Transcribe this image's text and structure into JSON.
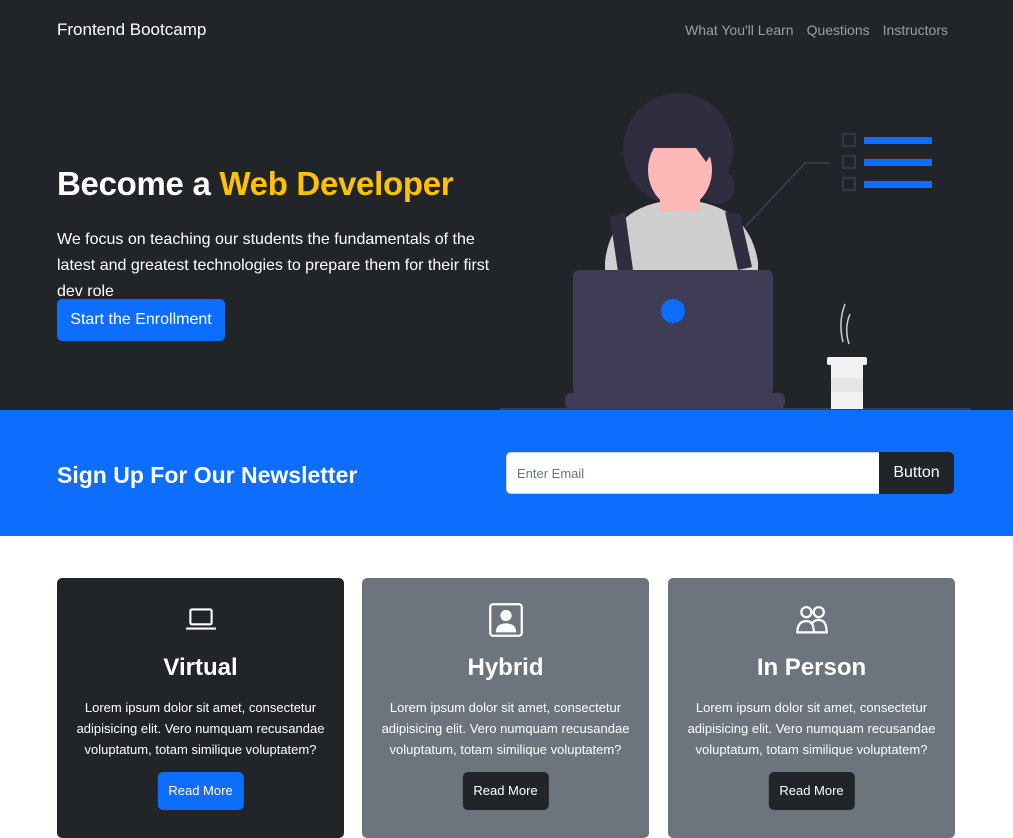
{
  "navbar": {
    "brand": "Frontend Bootcamp",
    "links": [
      "What You'll Learn",
      "Questions",
      "Instructors"
    ]
  },
  "hero": {
    "title_prefix": "Become a",
    "title_accent": "Web Developer",
    "description": "We focus on teaching our students the fundamentals of the latest and greatest technologies to prepare them for their first dev role",
    "cta_label": "Start the Enrollment"
  },
  "newsletter": {
    "heading": "Sign Up For Our Newsletter",
    "email_placeholder": "Enter Email",
    "email_value": "",
    "button_label": "Button"
  },
  "cards": [
    {
      "icon": "laptop-icon",
      "title": "Virtual",
      "text": "Lorem ipsum dolor sit amet, consectetur adipisicing elit. Vero numquam recusandae voluptatum, totam similique voluptatem?",
      "button": "Read More"
    },
    {
      "icon": "person-square-icon",
      "title": "Hybrid",
      "text": "Lorem ipsum dolor sit amet, consectetur adipisicing elit. Vero numquam recusandae voluptatum, totam similique voluptatem?",
      "button": "Read More"
    },
    {
      "icon": "people-icon",
      "title": "In Person",
      "text": "Lorem ipsum dolor sit amet, consectetur adipisicing elit. Vero numquam recusandae voluptatum, totam similique voluptatem?",
      "button": "Read More"
    }
  ],
  "colors": {
    "dark": "#212529",
    "primary": "#0d6efd",
    "accent": "#ffc107",
    "secondary": "#6c757d"
  }
}
